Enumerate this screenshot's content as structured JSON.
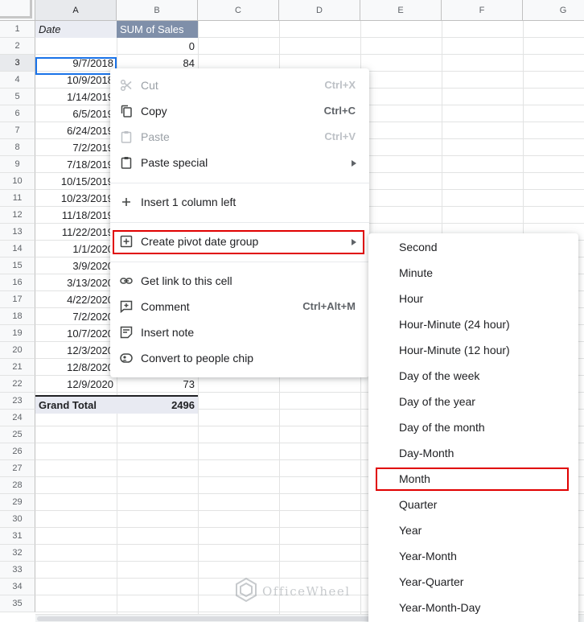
{
  "columns": [
    "A",
    "B",
    "C",
    "D",
    "E",
    "F",
    "G"
  ],
  "rows": [
    "1",
    "2",
    "3",
    "4",
    "5",
    "6",
    "7",
    "8",
    "9",
    "10",
    "11",
    "12",
    "13",
    "14",
    "15",
    "16",
    "17",
    "18",
    "19",
    "20",
    "21",
    "22",
    "23",
    "24",
    "25",
    "26",
    "27",
    "28",
    "29",
    "30",
    "31",
    "32",
    "33",
    "34",
    "35"
  ],
  "table": {
    "header": {
      "date": "Date",
      "sales": "SUM of Sales"
    },
    "rows": [
      {
        "date": "",
        "sales": "0"
      },
      {
        "date": "9/7/2018",
        "sales": "84"
      },
      {
        "date": "10/9/2018",
        "sales": ""
      },
      {
        "date": "1/14/2019",
        "sales": ""
      },
      {
        "date": "6/5/2019",
        "sales": ""
      },
      {
        "date": "6/24/2019",
        "sales": ""
      },
      {
        "date": "7/2/2019",
        "sales": ""
      },
      {
        "date": "7/18/2019",
        "sales": ""
      },
      {
        "date": "10/15/2019",
        "sales": ""
      },
      {
        "date": "10/23/2019",
        "sales": ""
      },
      {
        "date": "11/18/2019",
        "sales": ""
      },
      {
        "date": "11/22/2019",
        "sales": ""
      },
      {
        "date": "1/1/2020",
        "sales": ""
      },
      {
        "date": "3/9/2020",
        "sales": ""
      },
      {
        "date": "3/13/2020",
        "sales": ""
      },
      {
        "date": "4/22/2020",
        "sales": ""
      },
      {
        "date": "7/2/2020",
        "sales": ""
      },
      {
        "date": "10/7/2020",
        "sales": ""
      },
      {
        "date": "12/3/2020",
        "sales": ""
      },
      {
        "date": "12/8/2020",
        "sales": ""
      },
      {
        "date": "12/9/2020",
        "sales": "73"
      }
    ],
    "total": {
      "label": "Grand Total",
      "value": "2496"
    }
  },
  "context_menu": {
    "items": [
      {
        "label": "Cut",
        "shortcut": "Ctrl+X",
        "icon": "scissors-icon",
        "disabled": true
      },
      {
        "label": "Copy",
        "shortcut": "Ctrl+C",
        "icon": "copy-icon",
        "disabled": false
      },
      {
        "label": "Paste",
        "shortcut": "Ctrl+V",
        "icon": "clipboard-icon",
        "disabled": true
      },
      {
        "label": "Paste special",
        "shortcut": "",
        "icon": "clipboard-icon",
        "disabled": false,
        "submenu": true
      },
      {
        "label": "Insert 1 column left",
        "shortcut": "",
        "icon": "plus-icon",
        "disabled": false
      },
      {
        "label": "Create pivot date group",
        "shortcut": "",
        "icon": "plus-box-icon",
        "disabled": false,
        "submenu": true,
        "highlighted": true
      },
      {
        "label": "Get link to this cell",
        "shortcut": "",
        "icon": "link-icon",
        "disabled": false
      },
      {
        "label": "Comment",
        "shortcut": "Ctrl+Alt+M",
        "icon": "comment-add-icon",
        "disabled": false
      },
      {
        "label": "Insert note",
        "shortcut": "",
        "icon": "note-icon",
        "disabled": false
      },
      {
        "label": "Convert to people chip",
        "shortcut": "",
        "icon": "person-chip-icon",
        "disabled": false
      }
    ]
  },
  "submenu": {
    "items": [
      {
        "label": "Second"
      },
      {
        "label": "Minute"
      },
      {
        "label": "Hour"
      },
      {
        "label": "Hour-Minute (24 hour)"
      },
      {
        "label": "Hour-Minute (12 hour)"
      },
      {
        "label": "Day of the week"
      },
      {
        "label": "Day of the year"
      },
      {
        "label": "Day of the month"
      },
      {
        "label": "Day-Month"
      },
      {
        "label": "Month",
        "highlighted": true
      },
      {
        "label": "Quarter"
      },
      {
        "label": "Year"
      },
      {
        "label": "Year-Month"
      },
      {
        "label": "Year-Quarter"
      },
      {
        "label": "Year-Month-Day"
      }
    ]
  },
  "watermark": {
    "text": "OfficeWheel"
  },
  "colors": {
    "accent": "#1a73e8",
    "highlight": "#e00000",
    "pivot_header": "#7f8fa9"
  }
}
